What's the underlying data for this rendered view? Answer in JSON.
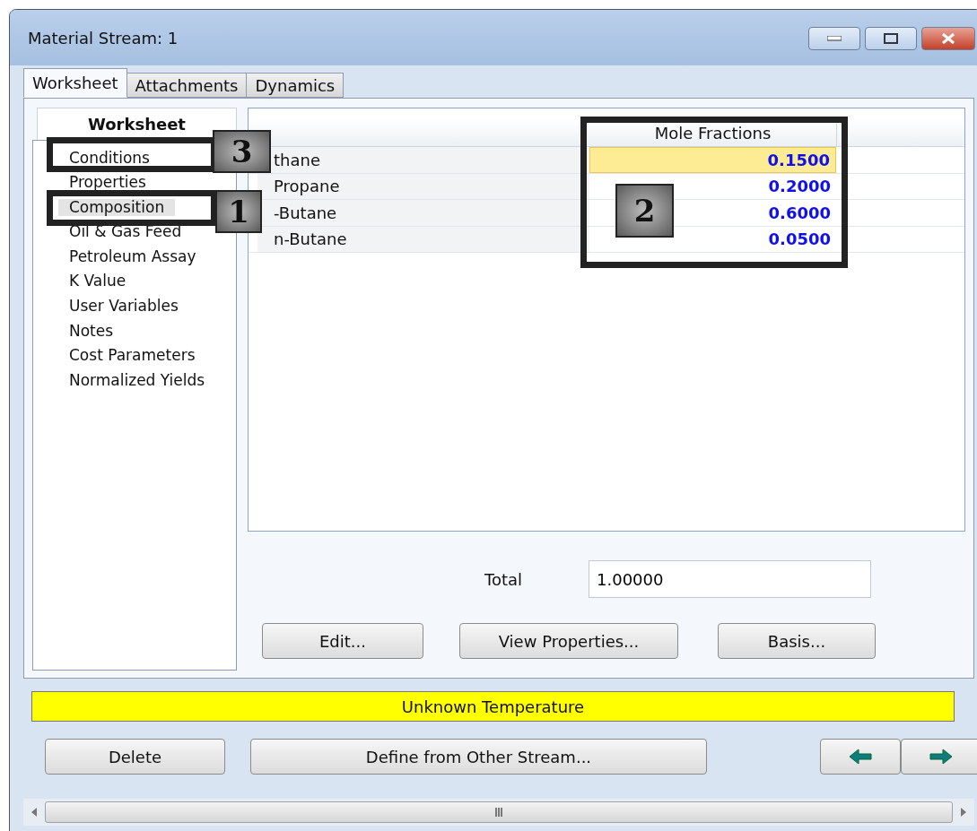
{
  "window": {
    "title": "Material Stream: 1"
  },
  "tabs": [
    {
      "label": "Worksheet",
      "selected": true
    },
    {
      "label": "Attachments",
      "selected": false
    },
    {
      "label": "Dynamics",
      "selected": false
    }
  ],
  "sidebar": {
    "title": "Worksheet",
    "items": [
      {
        "label": "Conditions",
        "selected": false
      },
      {
        "label": "Properties",
        "selected": false
      },
      {
        "label": "Composition",
        "selected": true
      },
      {
        "label": "Oil & Gas Feed",
        "selected": false
      },
      {
        "label": "Petroleum Assay",
        "selected": false
      },
      {
        "label": "K Value",
        "selected": false
      },
      {
        "label": "User Variables",
        "selected": false
      },
      {
        "label": "Notes",
        "selected": false
      },
      {
        "label": "Cost Parameters",
        "selected": false
      },
      {
        "label": "Normalized Yields",
        "selected": false
      }
    ]
  },
  "table": {
    "columns": [
      "Mole Fractions"
    ],
    "rows": [
      {
        "name": "thane",
        "value": "0.1500",
        "selected": true
      },
      {
        "name": "Propane",
        "value": "0.2000",
        "selected": false
      },
      {
        "name": "-Butane",
        "value": "0.6000",
        "selected": false
      },
      {
        "name": "n-Butane",
        "value": "0.0500",
        "selected": false
      }
    ]
  },
  "total": {
    "label": "Total",
    "value": "1.00000"
  },
  "buttons": [
    "Edit...",
    "View Properties...",
    "Basis..."
  ],
  "status_bar": {
    "text": "Unknown Temperature"
  },
  "footer_buttons": [
    {
      "kind": "text",
      "label": "Delete"
    },
    {
      "kind": "text",
      "label": "Define from Other Stream..."
    },
    {
      "kind": "arrow-left"
    },
    {
      "kind": "arrow-right"
    }
  ],
  "callouts": [
    {
      "label": "3"
    },
    {
      "label": "1"
    },
    {
      "label": "2"
    }
  ]
}
